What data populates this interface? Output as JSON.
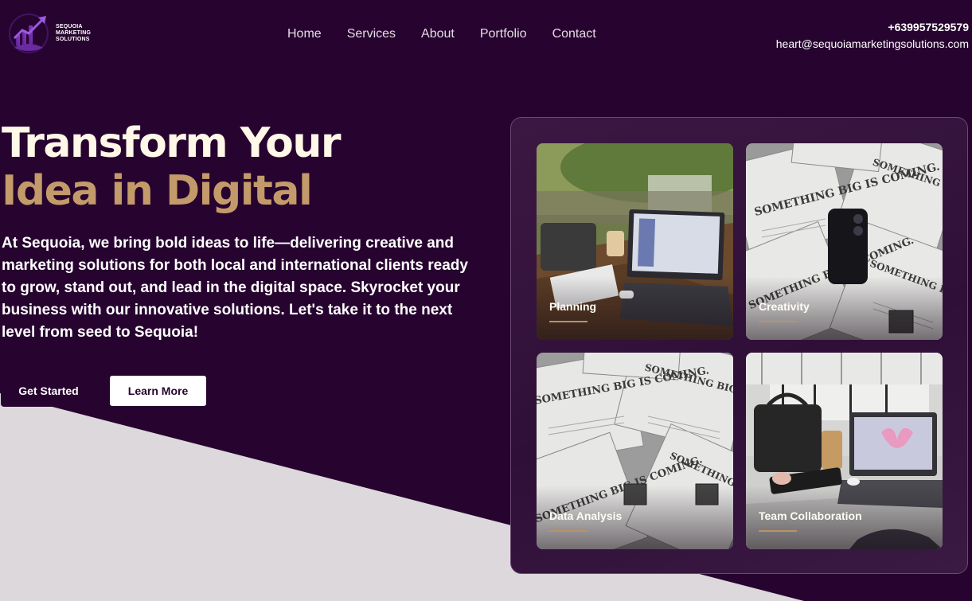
{
  "brand": {
    "name_line1": "SEQUOIA",
    "name_line2": "MARKETING",
    "name_line3": "SOLUTIONS"
  },
  "nav": {
    "items": [
      {
        "label": "Home"
      },
      {
        "label": "Services"
      },
      {
        "label": "About"
      },
      {
        "label": "Portfolio"
      },
      {
        "label": "Contact"
      }
    ]
  },
  "contact": {
    "phone": "+639957529579",
    "email": "heart@sequoiamarketingsolutions.com"
  },
  "hero": {
    "title_line1": "Transform Your",
    "title_line2": "Idea in Digital",
    "description": "At Sequoia, we bring bold ideas to life—delivering creative and marketing solutions for both local and international clients ready to grow, stand out, and lead in the digital space. Skyrocket your business with our innovative solutions. Let's take it to the next level from seed to Sequoia!",
    "primary_button": "Get Started",
    "secondary_button": "Learn More"
  },
  "gallery": {
    "cards": [
      {
        "label": "Planning"
      },
      {
        "label": "Creativity"
      },
      {
        "label": "Data Analysis"
      },
      {
        "label": "Team Collaboration"
      }
    ],
    "newspaper_headline": "SOMETHING BIG IS COMING."
  },
  "colors": {
    "background": "#27042f",
    "accent_gold": "#c39a6a",
    "title_cream": "#fff7e8",
    "slant_gray": "#ddd8dc"
  }
}
